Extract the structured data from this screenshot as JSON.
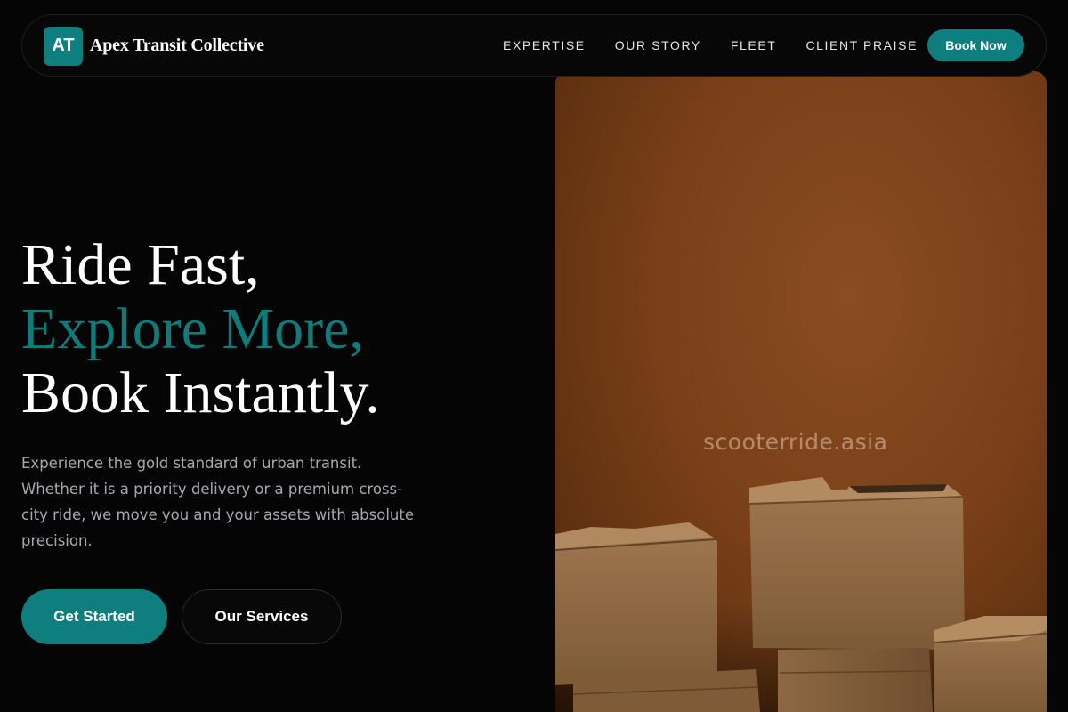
{
  "brand": {
    "badge": "AT",
    "name": "Apex Transit Collective"
  },
  "nav": {
    "links": [
      "EXPERTISE",
      "OUR STORY",
      "FLEET",
      "CLIENT PRAISE"
    ],
    "cta_label": "Book Now"
  },
  "hero": {
    "title_line1": "Ride Fast,",
    "title_line2": "Explore More,",
    "title_line3": "Book Instantly.",
    "description": "Experience the gold standard of urban transit. Whether it is a priority delivery or a premium cross-city ride, we move you and your assets with absolute precision.",
    "primary_button": "Get Started",
    "secondary_button": "Our Services",
    "image_watermark": "scooterride.asia"
  },
  "colors": {
    "accent": "#0f7e7e",
    "background": "#050505",
    "text_muted": "#a8a8ad",
    "image_backdrop": "#7a4019"
  },
  "icons": {
    "image": "cardboard-boxes-photo"
  }
}
